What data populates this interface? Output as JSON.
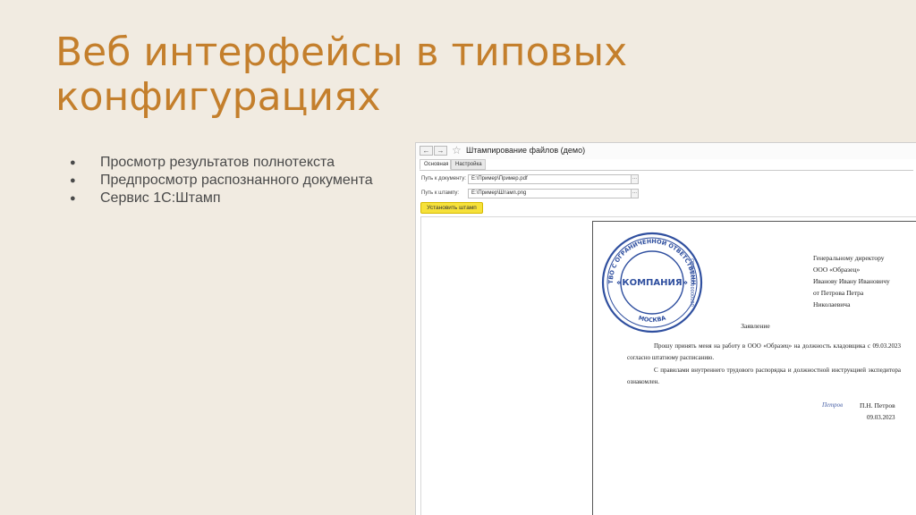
{
  "slide": {
    "title_line1": "Веб интерфейсы в типовых",
    "title_line2": "конфигурациях",
    "bullets": [
      "Просмотр результатов полнотекста",
      "Предпросмотр распознанного документа",
      "Сервис 1С:Штамп"
    ]
  },
  "app": {
    "title": "Штампирование файлов (демо)",
    "nav": {
      "back_icon": "arrow-left-icon",
      "forward_icon": "arrow-right-icon",
      "favorite_icon": "star-icon"
    },
    "tabs": [
      {
        "label": "Основная",
        "active": true
      },
      {
        "label": "Настройка",
        "active": false
      }
    ],
    "fields": {
      "document_label": "Путь к документу:",
      "document_value": "E:\\Пример\\Пример.pdf",
      "stamp_label": "Путь к штампу:",
      "stamp_value": "E:\\Пример\\Штамп.png",
      "browse_glyph": "..."
    },
    "stamp_button": "Установить штамп",
    "colors": {
      "button": "#f6e13a",
      "title": "#c47f2c",
      "stamp": "#2f4f9f"
    }
  },
  "document": {
    "stamp": {
      "center_text": "«КОМПАНИЯ»",
      "ring_text": "ОБЩЕСТВО С ОГРАНИЧЕННОЙ ОТВЕТСТВЕННОСТЬЮ",
      "ogrn": "ОГРН 000000000000",
      "city": "МОСКВА"
    },
    "addressee": [
      "Генеральному директору",
      "ООО «Образец»",
      "Иванову Ивану Ивановичу",
      "от Петрова Петра",
      "Николаевича"
    ],
    "heading": "Заявление",
    "paragraph1": "Прошу принять меня на работу в ООО «Образец» на должность кладовщика с 09.03.2023 согласно штатному расписанию.",
    "paragraph2": "С правилами внутреннего трудового распорядка и должностной инструкцией экспедитора ознакомлен.",
    "signature": "Петров",
    "signer_name": "П.Н. Петров",
    "date": "09.03.2023"
  }
}
